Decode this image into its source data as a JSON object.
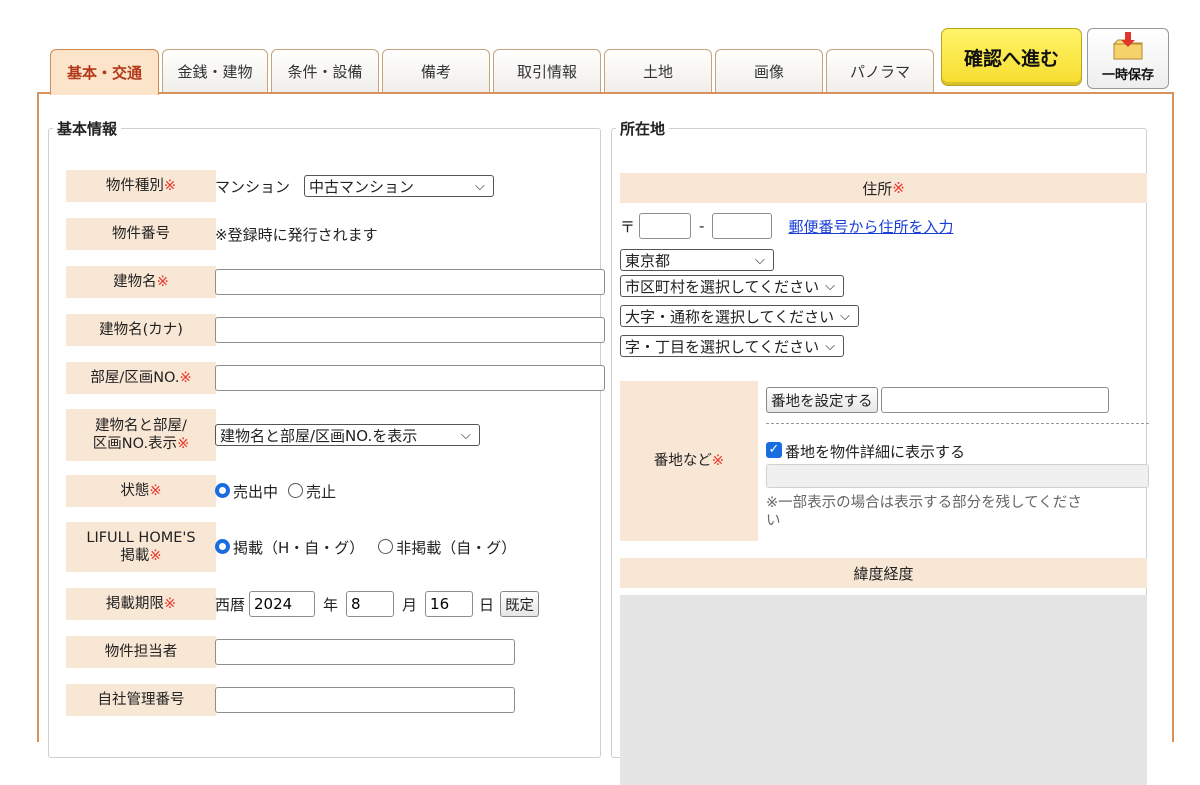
{
  "tabs": [
    {
      "label": "基本・交通",
      "active": true
    },
    {
      "label": "金銭・建物",
      "active": false
    },
    {
      "label": "条件・設備",
      "active": false
    },
    {
      "label": "備考",
      "active": false
    },
    {
      "label": "取引情報",
      "active": false
    },
    {
      "label": "土地",
      "active": false
    },
    {
      "label": "画像",
      "active": false
    },
    {
      "label": "パノラマ",
      "active": false
    }
  ],
  "actions": {
    "confirm_label": "確認へ進む",
    "save_label": "一時保存",
    "save_icon": "folder-download-icon"
  },
  "colors": {
    "accent": "#d9935a",
    "label_bg": "#f9e7d6",
    "required": "#e8382b",
    "confirm_bg": "#f7dc2c",
    "link": "#1a3fd6",
    "checkbox": "#1a6de0"
  },
  "basic": {
    "legend": "基本情報",
    "required_mark": "※",
    "property_type": {
      "label": "物件種別",
      "fixed_value": "マンション",
      "select_value": "中古マンション"
    },
    "property_number": {
      "label": "物件番号",
      "value": "※登録時に発行されます"
    },
    "building_name": {
      "label": "建物名",
      "value": ""
    },
    "building_name_kana": {
      "label": "建物名(カナ)",
      "value": ""
    },
    "room_number": {
      "label": "部屋/区画NO.",
      "value": ""
    },
    "display_option": {
      "label_line1": "建物名と部屋/",
      "label_line2": "区画NO.表示",
      "select_value": "建物名と部屋/区画NO.を表示"
    },
    "status": {
      "label": "状態",
      "options": [
        {
          "label": "売出中",
          "checked": true
        },
        {
          "label": "売止",
          "checked": false
        }
      ]
    },
    "listing": {
      "label_line1": "LIFULL HOME'S",
      "label_line2": "掲載",
      "options": [
        {
          "label": "掲載（H・自・グ）",
          "checked": true
        },
        {
          "label": "非掲載（自・グ）",
          "checked": false
        }
      ]
    },
    "period": {
      "label": "掲載期限",
      "era": "西暦",
      "year": "2024",
      "year_unit": "年",
      "month": "8",
      "month_unit": "月",
      "day": "16",
      "day_unit": "日",
      "default_button": "既定"
    },
    "staff": {
      "label": "物件担当者",
      "value": ""
    },
    "internal_number": {
      "label": "自社管理番号",
      "value": ""
    }
  },
  "location": {
    "legend": "所在地",
    "address_header": "住所",
    "postal_mark": "〒",
    "postal_dash": "-",
    "postal_first": "",
    "postal_second": "",
    "postal_link": "郵便番号から住所を入力",
    "prefecture": "東京都",
    "city": "市区町村を選択してください",
    "town": "大字・通称を選択してください",
    "chome": "字・丁目を選択してください",
    "lot": {
      "label": "番地など",
      "set_button": "番地を設定する",
      "value": "",
      "show_checkbox_label": "番地を物件詳細に表示する",
      "show_checked": true,
      "partial_value": "",
      "note_line1": "※一部表示の場合は表示する部分を残してくださ",
      "note_line2": "い"
    },
    "latlng_header": "緯度経度"
  }
}
